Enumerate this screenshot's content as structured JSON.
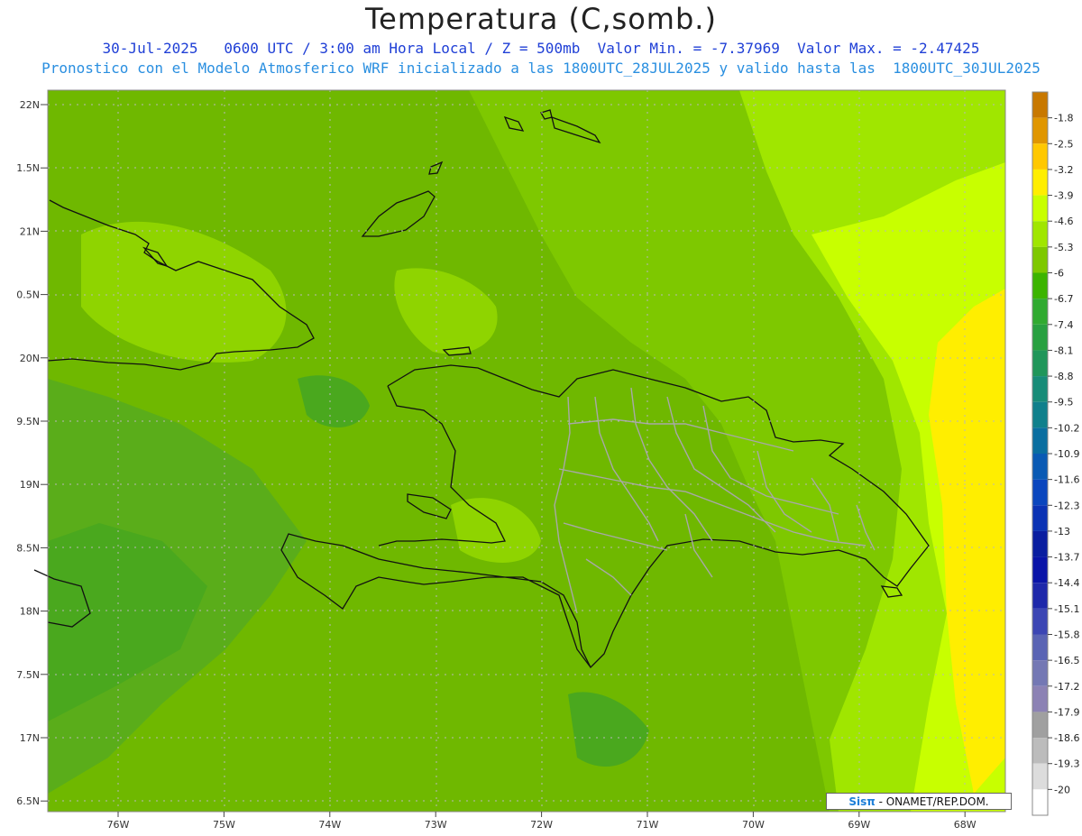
{
  "title": "Temperatura (C,somb.)",
  "subtitle1": "30-Jul-2025   0600 UTC / 3:00 am Hora Local / Z = 500mb  Valor Min. = -7.37969  Valor Max. = -2.47425",
  "subtitle2": "Pronostico con el Modelo Atmosferico WRF inicializado a las 1800UTC_28JUL2025 y valido hasta las  1800UTC_30JUL2025",
  "lat_labels": [
    "22N",
    "1.5N",
    "21N",
    "0.5N",
    "20N",
    "9.5N",
    "19N",
    "8.5N",
    "18N",
    "7.5N",
    "17N",
    "6.5N"
  ],
  "lon_labels": [
    "76W",
    "75W",
    "74W",
    "73W",
    "72W",
    "71W",
    "70W",
    "69W",
    "68W"
  ],
  "colorbar": {
    "labels": [
      "-1.8",
      "-2.5",
      "-3.2",
      "-3.9",
      "-4.6",
      "-5.3",
      "-6",
      "-6.7",
      "-7.4",
      "-8.1",
      "-8.8",
      "-9.5",
      "-10.2",
      "-10.9",
      "-11.6",
      "-12.3",
      "-13",
      "-13.7",
      "-14.4",
      "-15.1",
      "-15.8",
      "-16.5",
      "-17.2",
      "-17.9",
      "-18.6",
      "-19.3",
      "-20"
    ],
    "colors": [
      "#c87800",
      "#e09600",
      "#ffc800",
      "#ffee00",
      "#c8ff00",
      "#a0e600",
      "#7ec800",
      "#3cb400",
      "#30aa30",
      "#28a040",
      "#20965a",
      "#188c78",
      "#10808c",
      "#0a6ea0",
      "#0a5ab4",
      "#0a46be",
      "#0a32b4",
      "#0a1ea0",
      "#0a14a8",
      "#1e28aa",
      "#3c46b4",
      "#5a64b4",
      "#7478b4",
      "#8c82b4",
      "#a0a0a0",
      "#bcbcbc",
      "#dcdcdc",
      "#ffffff"
    ]
  },
  "map_colors": {
    "dark": "#6fb800",
    "mid": "#7ec800",
    "light": "#a0e600",
    "pale": "#c8ff00",
    "yellow": "#ffee00",
    "green": "#3cb400"
  },
  "credit": {
    "logo": "Sisπ",
    "text": " - ONAMET/REP.DOM."
  }
}
